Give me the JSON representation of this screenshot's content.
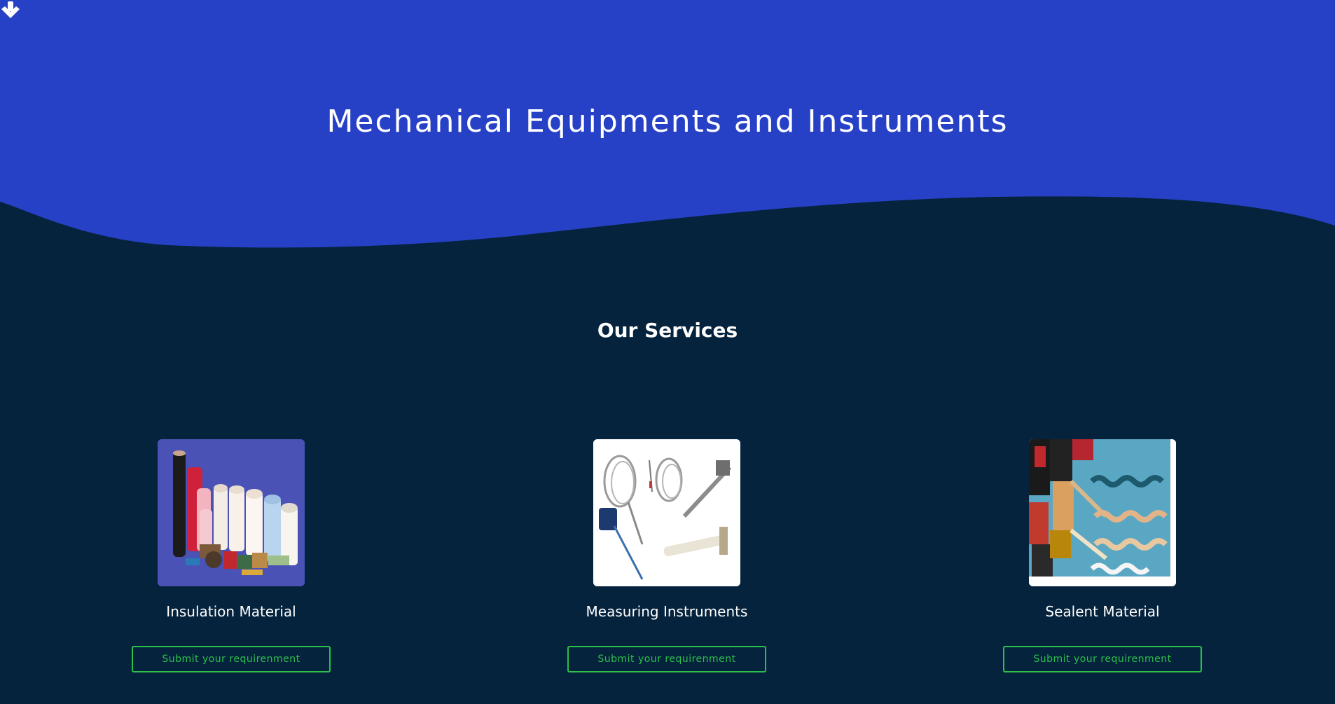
{
  "hero": {
    "title": "Mechanical Equipments and Instruments",
    "background_color": "#2741c6",
    "scroll_icon": "arrow-down-icon"
  },
  "services": {
    "title": "Our Services",
    "background_color": "#05233d",
    "button_color": "#2bc04a",
    "items": [
      {
        "name": "Insulation Material",
        "button_label": "Submit your requirenment",
        "image": "insulation-material-image"
      },
      {
        "name": "Measuring Instruments",
        "button_label": "Submit your requirenment",
        "image": "measuring-instruments-image"
      },
      {
        "name": "Sealent Material",
        "button_label": "Submit your requirenment",
        "image": "sealent-material-image"
      }
    ]
  }
}
